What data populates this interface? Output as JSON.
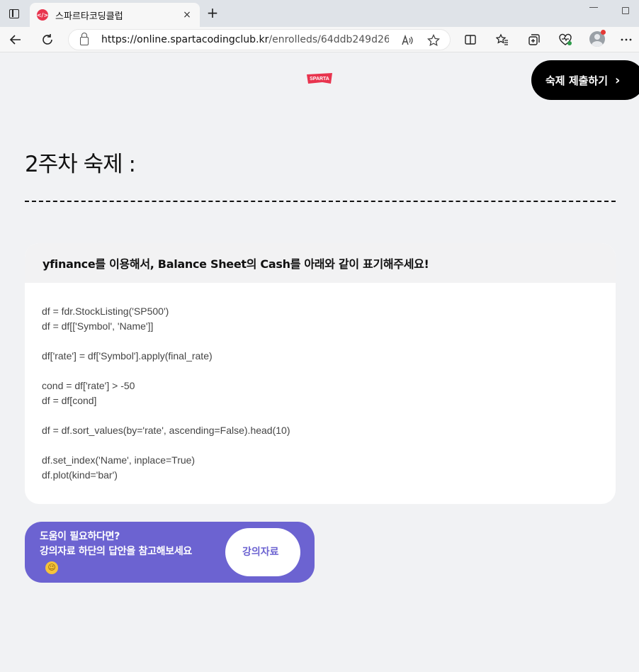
{
  "browser": {
    "tab_title": "스파르타코딩클럽",
    "tab_close": "×",
    "new_tab": "+",
    "url_host": "https://online.spartacodingclub.kr",
    "url_path": "/enrolleds/64ddb249d26fd5c0...",
    "favicon_text": "</>"
  },
  "header": {
    "logo_text": "SPARTA",
    "submit_label": "숙제 제출하기",
    "submit_chevron": "›"
  },
  "main": {
    "title": "2주차 숙제 :",
    "card_title": "yfinance를 이용해서, Balance Sheet의 Cash를 아래와 같이 표기해주세요!",
    "code_lines": [
      "df = fdr.StockListing('SP500')",
      "df = df[['Symbol', 'Name']]",
      "",
      "df['rate'] = df['Symbol'].apply(final_rate)",
      "",
      "cond = df['rate'] > -50",
      "df = df[cond]",
      "",
      "df = df.sort_values(by='rate', ascending=False).head(10)",
      "",
      "df.set_index('Name', inplace=True)",
      "df.plot(kind='bar')"
    ]
  },
  "help": {
    "line1": "도움이 필요하다면?",
    "line2": "강의자료 하단의 답안을 참고해보세요",
    "emoji": "😉",
    "button_label": "강의자료"
  },
  "colors": {
    "accent": "#6c63d1",
    "brand": "#e8344e"
  }
}
